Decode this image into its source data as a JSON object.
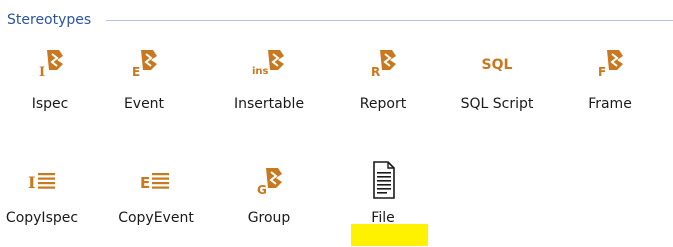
{
  "group": {
    "title": "Stereotypes"
  },
  "items": [
    {
      "label": "Ispec",
      "letter": "I",
      "icon": "ispec-icon"
    },
    {
      "label": "Event",
      "letter": "E",
      "icon": "event-icon"
    },
    {
      "label": "Insertable",
      "letter": "ins",
      "icon": "insertable-icon"
    },
    {
      "label": "Report",
      "letter": "R",
      "icon": "report-icon"
    },
    {
      "label": "SQL Script",
      "letter": "SQL",
      "icon": "sql-script-icon"
    },
    {
      "label": "Frame",
      "letter": "F",
      "icon": "frame-icon"
    },
    {
      "label": "CopyIspec",
      "letter": "I",
      "icon": "copy-ispec-icon"
    },
    {
      "label": "CopyEvent",
      "letter": "E",
      "icon": "copy-event-icon"
    },
    {
      "label": "Group",
      "letter": "G",
      "icon": "group-icon"
    },
    {
      "label": "File",
      "letter": "",
      "icon": "file-icon"
    }
  ],
  "colors": {
    "icon_orange": "#c8781e",
    "title_blue": "#2b55a4",
    "highlight": "#fff200"
  }
}
